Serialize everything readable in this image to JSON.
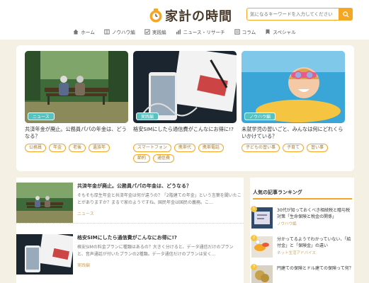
{
  "header": {
    "logo_text": "家計の時間",
    "search_placeholder": "気になるキーワードを入力してください",
    "nav": [
      {
        "label": "ホーム",
        "icon": "home-icon"
      },
      {
        "label": "ノウハウ編",
        "icon": "book-icon"
      },
      {
        "label": "実践編",
        "icon": "check-icon"
      },
      {
        "label": "ニュース・リサーチ",
        "icon": "chart-icon"
      },
      {
        "label": "コラム",
        "icon": "note-icon"
      },
      {
        "label": "スペシャル",
        "icon": "bookmark-icon"
      }
    ]
  },
  "featured": [
    {
      "badge": "ニュース",
      "title": "共済年金が廃止。公務員パパの年金は、どうなる？",
      "tags": [
        "公務員",
        "年金",
        "老後",
        "遺族年"
      ]
    },
    {
      "badge": "実践編",
      "title": "格安SIMにしたら通信費がこんなにお得に!?",
      "tags": [
        "スマートフォン",
        "携帯代",
        "携帯電話",
        "節約",
        "通信費"
      ]
    },
    {
      "badge": "ノウハウ編",
      "title": "未就学児の習いごと、みんなは何にどれくらいかけている？",
      "tags": [
        "子どもの習い事",
        "子育て",
        "習い事"
      ]
    }
  ],
  "articles": [
    {
      "title": "共済年金が廃止。公務員パパの年金は、どうなる？",
      "excerpt": "そもそも厚生年金と共済年金は何が違うの？「2階建ての年金」という言葉を聞いたことがありますか？まるで家のようですね。国民年金は国民の義務。こ…",
      "category": "ニュース"
    },
    {
      "title": "格安SIMにしたら通信費がこんなにお得に!?",
      "excerpt": "格安SIMの料金プランに種類はあるの？大きく分けると、データ通信だけのプランと、音声通話が付いたプランの2種類。データ通信だけのプランは安く…",
      "category": "実践編"
    }
  ],
  "sidebar": {
    "heading": "人気の記事ランキング",
    "ranking": [
      {
        "num": "1",
        "title": "30代が知っておくべき相続税と贈与税対策「生命保険と税金の関係」",
        "category": "ノウハウ編"
      },
      {
        "num": "2",
        "title": "分かってるようでわかっていない、「給付金」と「保険金」の違い",
        "category": "ネット生活アドバイス"
      },
      {
        "num": "3",
        "title": "円建ての保険とドル建ての保険って何？",
        "category": ""
      }
    ]
  },
  "colors": {
    "accent": "#f5a623",
    "background": "#f5f0e4",
    "badge_news": "#57c3c0",
    "badge_jissen": "#57c3c0",
    "badge_knowhow": "#57c3c0"
  }
}
